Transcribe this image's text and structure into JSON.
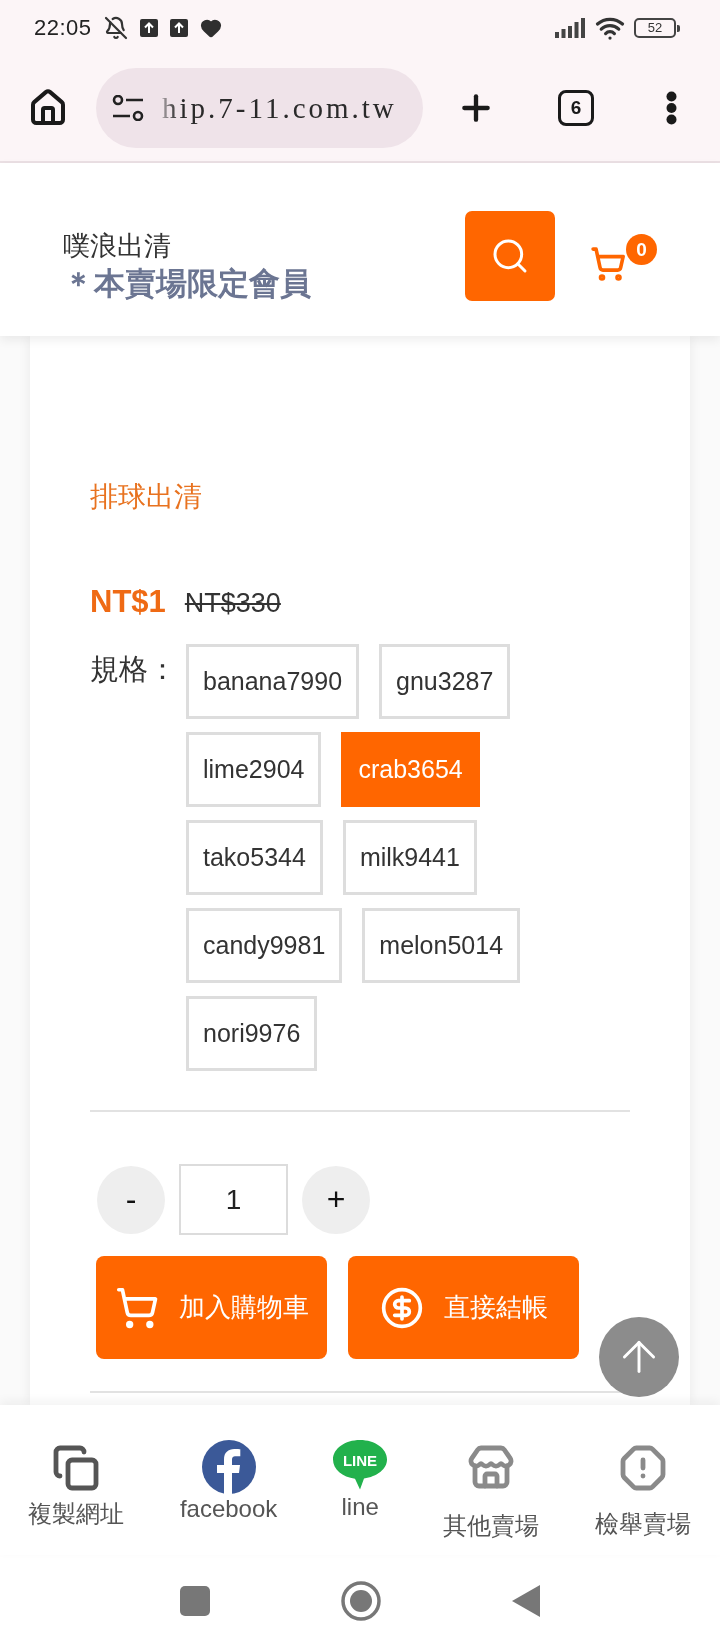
{
  "status_bar": {
    "time": "22:05",
    "battery": "52"
  },
  "browser": {
    "url": "hip.7-11.com.tw",
    "tab_count": "6"
  },
  "header": {
    "shop_name": "噗浪出清",
    "notice": "＊本賣場限定會員",
    "cart_count": "0"
  },
  "product": {
    "title": "排球出清",
    "price": "NT$1",
    "original_price": "NT$330",
    "spec_label": "規格：",
    "options": [
      {
        "label": "banana7990",
        "selected": false
      },
      {
        "label": "gnu3287",
        "selected": false
      },
      {
        "label": "lime2904",
        "selected": false
      },
      {
        "label": "crab3654",
        "selected": true
      },
      {
        "label": "tako5344",
        "selected": false
      },
      {
        "label": "milk9441",
        "selected": false
      },
      {
        "label": "candy9981",
        "selected": false
      },
      {
        "label": "melon5014",
        "selected": false
      },
      {
        "label": "nori9976",
        "selected": false
      }
    ],
    "quantity": {
      "minus": "-",
      "value": "1",
      "plus": "+"
    },
    "actions": [
      {
        "kind": "cart",
        "label": "加入購物車"
      },
      {
        "kind": "checkout",
        "label": "直接結帳"
      }
    ]
  },
  "share_bar": [
    {
      "kind": "copy",
      "label": "複製網址"
    },
    {
      "kind": "facebook",
      "label": "facebook"
    },
    {
      "kind": "line",
      "label": "line",
      "logo_text": "LINE"
    },
    {
      "kind": "store",
      "label": "其他賣場"
    },
    {
      "kind": "report",
      "label": "檢舉賣場"
    }
  ]
}
